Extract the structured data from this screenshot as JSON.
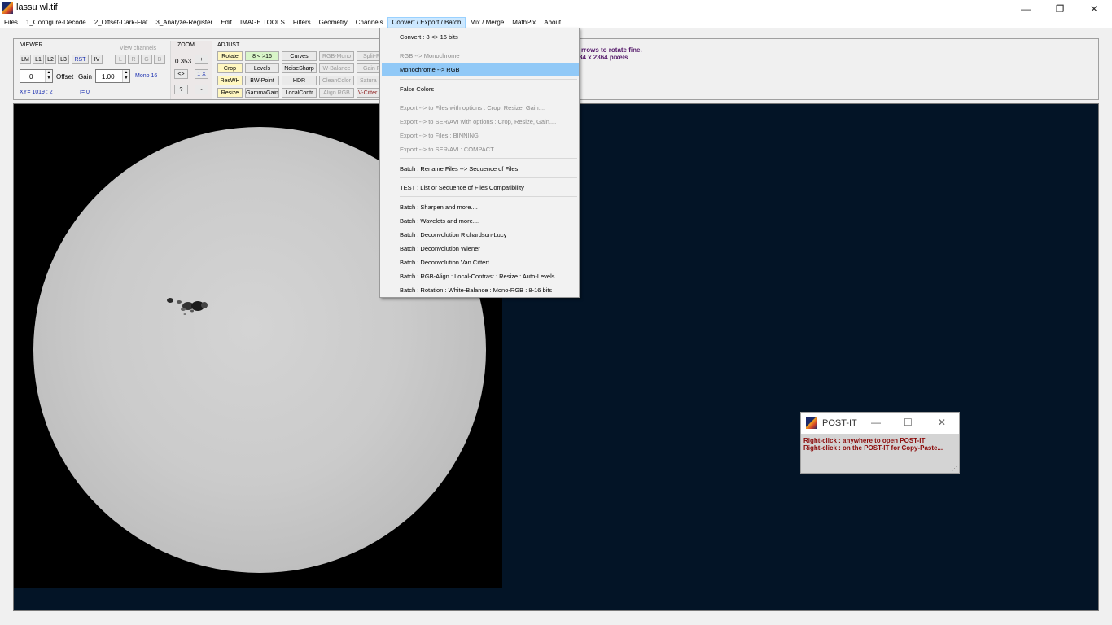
{
  "window": {
    "title": "lassu wl.tif",
    "minimize": "—",
    "maximize": "❐",
    "close": "✕"
  },
  "menubar": [
    "Files",
    "1_Configure-Decode",
    "2_Offset-Dark-Flat",
    "3_Analyze-Register",
    "Edit",
    "IMAGE TOOLS",
    "Filters",
    "Geometry",
    "Channels",
    "Convert / Export / Batch",
    "Mix / Merge",
    "MathPix",
    "About"
  ],
  "viewer": {
    "label": "VIEWER",
    "buttons": [
      "LM",
      "L1",
      "L2",
      "L3",
      "RST",
      "IV"
    ],
    "view_channels_label": "View channels",
    "channel_buttons": [
      "L",
      "R",
      "G",
      "B"
    ],
    "offset_value": "0",
    "offset_label": "Offset",
    "gain_label": "Gain",
    "gain_value": "1.00",
    "mode": "Mono 16",
    "xy_readout": "XY=  1019 : 2",
    "intensity_readout": "I=  0"
  },
  "zoom": {
    "label": "ZOOM",
    "value": "0.353",
    "plus": "+",
    "fit": "<>",
    "one_x": "1 X",
    "help": "?",
    "minus": "-"
  },
  "adjust": {
    "label": "ADJUST",
    "col1": [
      "Rotate",
      "Crop",
      "ResWH",
      "Resize"
    ],
    "col2": [
      "8 < >16",
      "Levels",
      "BW-Point",
      "GammaGain"
    ],
    "col3": [
      "Curves",
      "NoiseSharp",
      "HDR",
      "LocalContr"
    ],
    "col4": [
      "RGB-Mono",
      "W-Balance",
      "CleanColor",
      "Align RGB"
    ],
    "col5": [
      "Split-R",
      "Gain R",
      "Satura",
      "V-Citter"
    ]
  },
  "info": {
    "line1": "rrows to rotate fine.",
    "line2": "84  x  2364  pixels"
  },
  "dropdown": {
    "items": [
      {
        "label": "Convert :  8 <> 16 bits",
        "enabled": true
      },
      {
        "label": "RGB  --> Monochrome",
        "enabled": false
      },
      {
        "label": "Monochrome  --> RGB",
        "enabled": true,
        "highlighted": true
      },
      {
        "label": "False Colors",
        "enabled": true
      },
      {
        "label": "Export  --> to Files with options : Crop, Resize, Gain....",
        "enabled": false
      },
      {
        "label": "Export  --> to SER/AVI with options : Crop, Resize, Gain....",
        "enabled": false
      },
      {
        "label": "Export  --> to Files : BINNING",
        "enabled": false
      },
      {
        "label": "Export  --> to SER/AVI : COMPACT",
        "enabled": false
      },
      {
        "label": "Batch : Rename Files  -->  Sequence of Files",
        "enabled": true
      },
      {
        "label": "TEST  :  List or Sequence of Files Compatibility",
        "enabled": true
      },
      {
        "label": "Batch : Sharpen and more....",
        "enabled": true
      },
      {
        "label": "Batch : Wavelets and more....",
        "enabled": true
      },
      {
        "label": "Batch : Deconvolution Richardson-Lucy",
        "enabled": true
      },
      {
        "label": "Batch : Deconvolution Wiener",
        "enabled": true
      },
      {
        "label": "Batch : Deconvolution Van Cittert",
        "enabled": true
      },
      {
        "label": "Batch : RGB-Align :  Local-Contrast :  Resize :  Auto-Levels",
        "enabled": true
      },
      {
        "label": "Batch : Rotation : White-Balance  :  Mono-RGB  :  8-16 bits",
        "enabled": true
      }
    ]
  },
  "postit": {
    "title": "POST-IT",
    "line1": "Right-click : anywhere to open POST-IT",
    "line2": "Right-click : on the POST-IT for Copy-Paste...",
    "minimize": "—",
    "maximize": "☐",
    "close": "✕"
  },
  "colors": {
    "canvas_background": "#031426",
    "menu_highlight": "#91c9f7",
    "postit_text": "#8b0a0a",
    "info_text": "#551a6b"
  }
}
